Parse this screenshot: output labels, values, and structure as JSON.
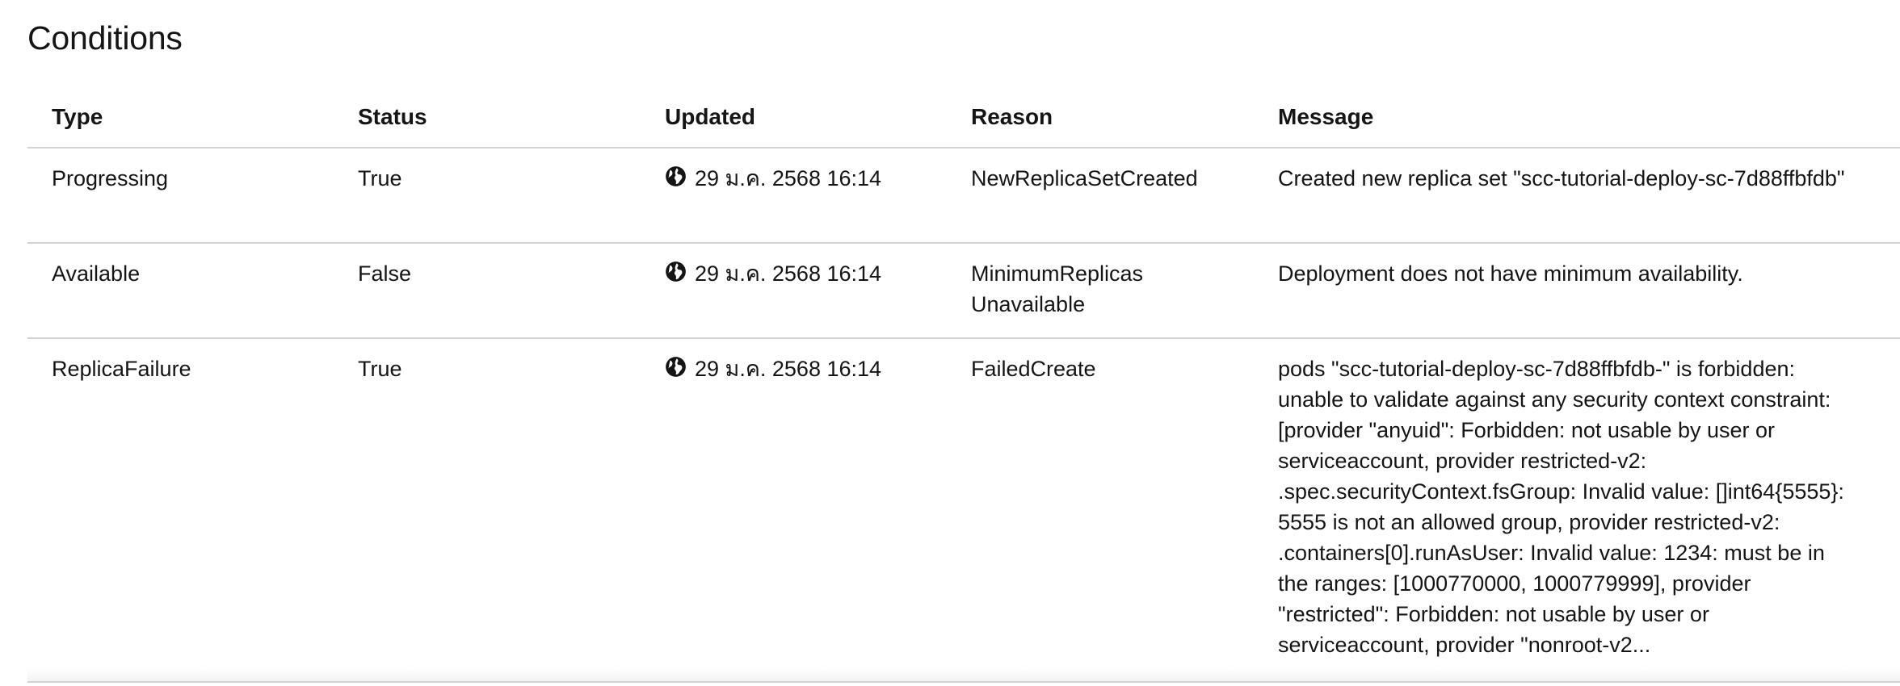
{
  "section": {
    "title": "Conditions"
  },
  "table": {
    "columns": [
      "Type",
      "Status",
      "Updated",
      "Reason",
      "Message"
    ],
    "rows": [
      {
        "type": "Progressing",
        "status": "True",
        "updated": "29 ม.ค. 2568 16:14",
        "reason": "NewReplicaSetCreated",
        "message": "Created new replica set \"scc-tutorial-deploy-sc-7d88ffbfdb\""
      },
      {
        "type": "Available",
        "status": "False",
        "updated": "29 ม.ค. 2568 16:14",
        "reason": "MinimumReplicas Unavailable",
        "message": "Deployment does not have minimum availability."
      },
      {
        "type": "ReplicaFailure",
        "status": "True",
        "updated": "29 ม.ค. 2568 16:14",
        "reason": "FailedCreate",
        "message": "pods \"scc-tutorial-deploy-sc-7d88ffbfdb-\" is forbidden: unable to validate against any security context constraint: [provider \"anyuid\": Forbidden: not usable by user or serviceaccount, provider restricted-v2: .spec.securityContext.fsGroup: Invalid value: []int64{5555}: 5555 is not an allowed group, provider restricted-v2: .containers[0].runAsUser: Invalid value: 1234: must be in the ranges: [1000770000, 1000779999], provider \"restricted\": Forbidden: not usable by user or serviceaccount, provider \"nonroot-v2..."
      }
    ]
  },
  "icons": {
    "updated_icon": "globe-icon"
  }
}
